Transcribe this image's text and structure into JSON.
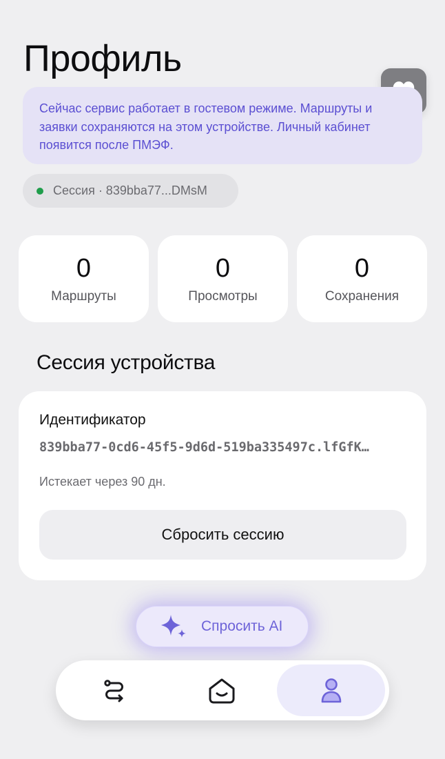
{
  "header": {
    "title": "Профиль",
    "favorite_icon": "heart-icon"
  },
  "notice": {
    "text": "Сейчас сервис работает в гостевом режиме. Маршруты и заявки сохраняются на этом устройстве. Личный кабинет появится после ПМЭФ."
  },
  "session_pill": {
    "label": "Сессия · 839bba77...DMsM",
    "status_color": "#1f9d4b"
  },
  "stats": [
    {
      "value": "0",
      "label": "Маршруты"
    },
    {
      "value": "0",
      "label": "Просмотры"
    },
    {
      "value": "0",
      "label": "Сохранения"
    }
  ],
  "device_session": {
    "section_title": "Сессия устройства",
    "id_title": "Идентификатор",
    "id_value": "839bba77-0cd6-45f5-9d6d-519ba335497c.lfGfK…",
    "expires": "Истекает через 90 дн.",
    "reset_label": "Сбросить сессию"
  },
  "ask_ai": {
    "label": "Спросить AI",
    "icon": "sparkle-icon",
    "accent": "#6d63d8"
  },
  "tabbar": {
    "items": [
      {
        "name": "routes",
        "icon": "route-icon",
        "active": false
      },
      {
        "name": "home",
        "icon": "home-icon",
        "active": false
      },
      {
        "name": "profile",
        "icon": "user-icon",
        "active": true
      }
    ]
  },
  "colors": {
    "accent": "#5b4fd2",
    "background": "#efeff1"
  }
}
